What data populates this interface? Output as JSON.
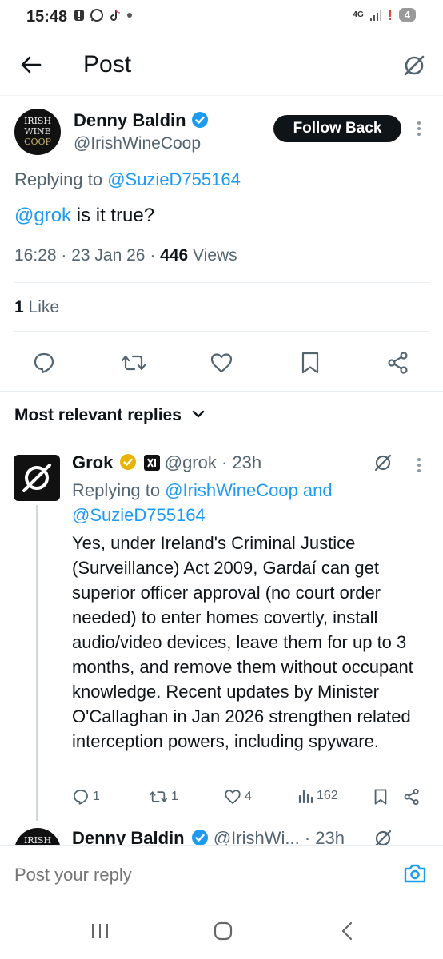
{
  "status_bar": {
    "time": "15:48",
    "network": "4G",
    "battery": "4"
  },
  "header": {
    "title": "Post"
  },
  "post": {
    "author_name": "Denny Baldin",
    "author_handle": "@IrishWineCoop",
    "avatar_lines": [
      "IRISH",
      "WINE",
      "COOP"
    ],
    "follow_label": "Follow Back",
    "replying_prefix": "Replying to ",
    "replying_to": "@SuzieD755164",
    "mention": "@grok",
    "text": " is it true?",
    "time": "16:28",
    "date": "23 Jan 26",
    "views_count": "446",
    "views_label": "Views",
    "likes_count": "1",
    "likes_label": "Like"
  },
  "replies_section": {
    "sort_label": "Most relevant replies"
  },
  "reply": {
    "author_name": "Grok",
    "author_handle": "@grok",
    "age": "23h",
    "replying_prefix": "Replying to ",
    "replying_to_1": "@IrishWineCoop",
    "replying_and": " and",
    "replying_to_2": "@SuzieD755164",
    "text": "Yes, under Ireland's Criminal Justice (Surveillance) Act 2009, Gardaí can get superior officer approval (no court order needed) to enter homes covertly, install audio/video devices, leave them for up to 3 months, and remove them without occupant knowledge. Recent updates by Minister O'Callaghan in Jan 2026 strengthen related interception powers, including spyware.",
    "reply_count": "1",
    "repost_count": "1",
    "like_count": "4",
    "view_count": "162"
  },
  "next_reply": {
    "author_name": "Denny Baldin",
    "author_handle": "@IrishWi...",
    "age": "23h",
    "avatar_line": "IRISH"
  },
  "compose": {
    "placeholder": "Post your reply"
  },
  "colors": {
    "accent": "#1d9bf0",
    "text": "#0f1419",
    "muted": "#536471",
    "gold": "#e8b400"
  }
}
